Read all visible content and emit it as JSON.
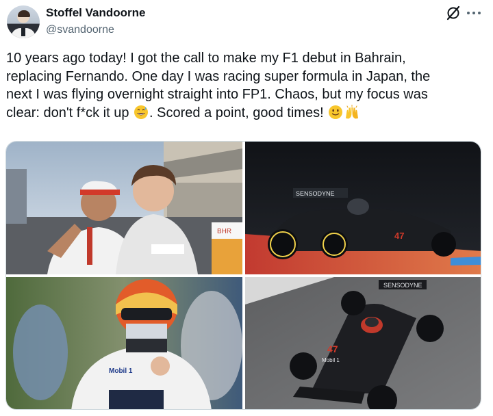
{
  "author": {
    "display_name": "Stoffel Vandoorne",
    "handle": "@svandoorne"
  },
  "tweet": {
    "line1": "10 years ago today! I got the call to make my F1 debut in Bahrain,",
    "line2": "replacing Fernando. One day I was racing super formula in Japan, the",
    "line3": "next I was flying overnight straight into FP1. Chaos, but my focus was",
    "line4a": "clear: don't f*ck it up ",
    "line4b": ". Scored a point, good times! "
  },
  "icons": {
    "grok": "grok-slash-circle-icon",
    "more": "more-horizontal-icon",
    "emoji1": "grinning-sweat-emoji",
    "emoji2": "slight-smile-emoji",
    "emoji3": "raised-hands-emoji"
  },
  "media": {
    "photo2_sponsor": "SENSODYNE",
    "photo4_sponsor": "SENSODYNE",
    "car_number": "47",
    "car_sponsor": "Mobil 1",
    "suit_sponsor": "Mobil 1",
    "sign_text": "BHR"
  },
  "colors": {
    "text_primary": "#0f1419",
    "text_secondary": "#536471",
    "border": "#cfd9de"
  }
}
